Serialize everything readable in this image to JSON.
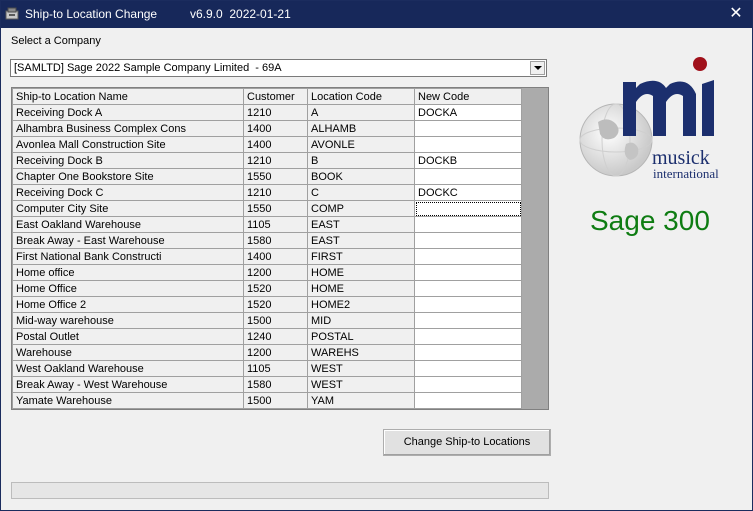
{
  "window": {
    "title": "Ship-to Location Change",
    "version": "v6.9.0  2022-01-21",
    "close_glyph": "✕"
  },
  "company": {
    "label": "Select a Company",
    "selected": "[SAMLTD] Sage 2022 Sample Company Limited  - 69A"
  },
  "grid": {
    "columns": [
      "Ship-to Location Name",
      "Customer",
      "Location Code",
      "New Code"
    ],
    "rows": [
      [
        "Receiving Dock A",
        "1210",
        "A",
        "DOCKA"
      ],
      [
        "Alhambra Business Complex Cons",
        "1400",
        "ALHAMB",
        ""
      ],
      [
        "Avonlea Mall Construction Site",
        "1400",
        "AVONLE",
        ""
      ],
      [
        "Receiving Dock B",
        "1210",
        "B",
        "DOCKB"
      ],
      [
        "Chapter One Bookstore Site",
        "1550",
        "BOOK",
        ""
      ],
      [
        "Receiving Dock C",
        "1210",
        "C",
        "DOCKC"
      ],
      [
        "Computer City Site",
        "1550",
        "COMP",
        ""
      ],
      [
        "East Oakland Warehouse",
        "1105",
        "EAST",
        ""
      ],
      [
        "Break Away - East Warehouse",
        "1580",
        "EAST",
        ""
      ],
      [
        "First National Bank Constructi",
        "1400",
        "FIRST",
        ""
      ],
      [
        "Home office",
        "1200",
        "HOME",
        ""
      ],
      [
        "Home Office",
        "1520",
        "HOME",
        ""
      ],
      [
        "Home Office 2",
        "1520",
        "HOME2",
        ""
      ],
      [
        "Mid-way warehouse",
        "1500",
        "MID",
        ""
      ],
      [
        "Postal Outlet",
        "1240",
        "POSTAL",
        ""
      ],
      [
        "Warehouse",
        "1200",
        "WAREHS",
        ""
      ],
      [
        "West Oakland Warehouse",
        "1105",
        "WEST",
        ""
      ],
      [
        "Break Away - West Warehouse",
        "1580",
        "WEST",
        ""
      ],
      [
        "Yamate Warehouse",
        "1500",
        "YAM",
        ""
      ]
    ],
    "focused_row": 6
  },
  "logo": {
    "brand_line1": "musick",
    "brand_line2": "international",
    "colors": {
      "navy": "#1c2f6e",
      "red": "#a0101a",
      "green": "#0e7c12"
    }
  },
  "product_label": "Sage 300",
  "actions": {
    "change_button": "Change Ship-to Locations"
  },
  "progress": {
    "value": 0
  }
}
